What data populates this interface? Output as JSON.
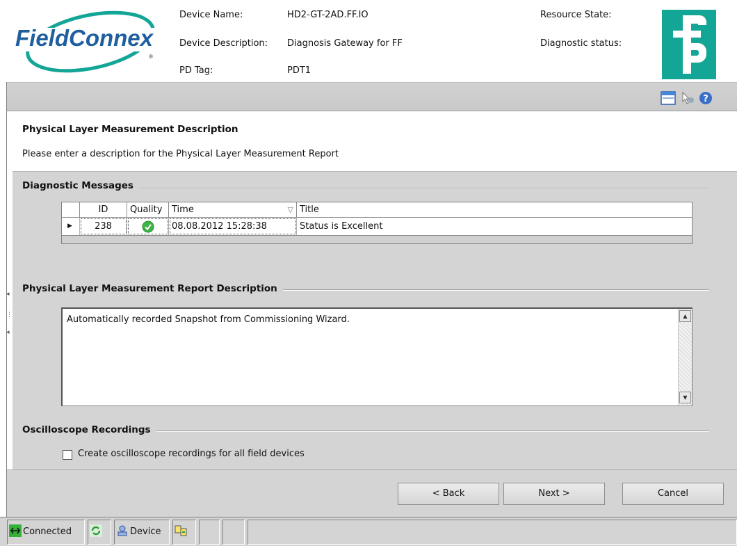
{
  "header": {
    "brand": "FieldConnex",
    "device_name_label": "Device Name:",
    "device_name_value": "HD2-GT-2AD.FF.IO",
    "device_description_label": "Device Description:",
    "device_description_value": "Diagnosis Gateway for FF",
    "pd_tag_label": "PD Tag:",
    "pd_tag_value": "PDT1",
    "resource_state_label": "Resource State:",
    "diagnostic_status_label": "Diagnostic status:"
  },
  "toolbar": {
    "icons": [
      "window-icon",
      "pointer-help-icon",
      "help-icon"
    ]
  },
  "description_panel": {
    "title": "Physical Layer Measurement Description",
    "text": "Please enter a description for the Physical Layer Measurement Report"
  },
  "diagnostic_messages": {
    "title": "Diagnostic Messages",
    "columns": [
      "ID",
      "Quality",
      "Time",
      "Title"
    ],
    "rows": [
      {
        "id": "238",
        "quality_icon": "check-circle-icon",
        "time": "08.08.2012 15:28:38",
        "title": "Status is Excellent"
      }
    ]
  },
  "report_description": {
    "title": "Physical Layer Measurement Report Description",
    "value": "Automatically recorded Snapshot from Commissioning Wizard."
  },
  "oscilloscope": {
    "title": "Oscilloscope Recordings",
    "checkbox_label": "Create oscilloscope recordings for all field devices",
    "checked": false
  },
  "buttons": {
    "back": "< Back",
    "next": "Next >",
    "cancel": "Cancel"
  },
  "statusbar": {
    "connected": "Connected",
    "device": "Device"
  },
  "colors": {
    "brand_teal": "#13a596",
    "logo_blue": "#1f5fa0",
    "panel_gray": "#d4d4d4",
    "ok_green": "#3fb447"
  }
}
